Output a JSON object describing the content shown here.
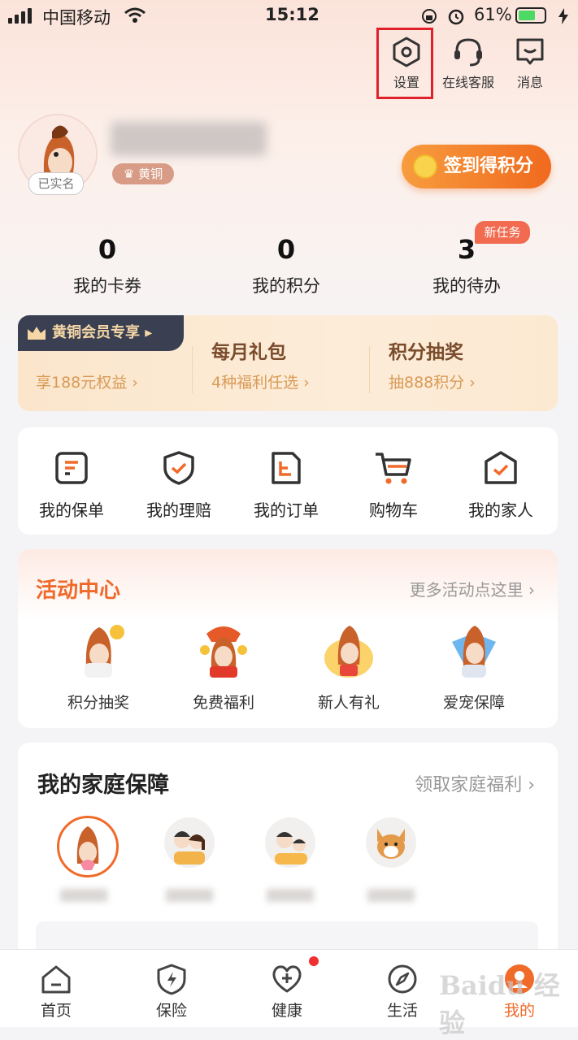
{
  "status_bar": {
    "carrier": "中国移动",
    "time": "15:12",
    "battery": "61%"
  },
  "top_actions": [
    {
      "label": "设置",
      "icon": "gear-hex-icon"
    },
    {
      "label": "在线客服",
      "icon": "headset-icon"
    },
    {
      "label": "消息",
      "icon": "message-icon"
    }
  ],
  "profile": {
    "verified": "已实名",
    "level": "黄铜",
    "signin": "签到得积分"
  },
  "stats": [
    {
      "value": "0",
      "label": "我的卡券"
    },
    {
      "value": "0",
      "label": "我的积分"
    },
    {
      "value": "3",
      "label": "我的待办"
    }
  ],
  "new_task_badge": "新任务",
  "member": {
    "tag": "黄铜会员专享 ▸",
    "tag_sub": "享188元权益 ›",
    "items": [
      {
        "title": "每月礼包",
        "sub": "4种福利任选 ›"
      },
      {
        "title": "积分抽奖",
        "sub": "抽888积分 ›"
      }
    ]
  },
  "menu": [
    {
      "label": "我的保单",
      "icon": "policy-icon"
    },
    {
      "label": "我的理赔",
      "icon": "shield-check-icon"
    },
    {
      "label": "我的订单",
      "icon": "order-icon"
    },
    {
      "label": "购物车",
      "icon": "cart-icon"
    },
    {
      "label": "我的家人",
      "icon": "family-icon"
    }
  ],
  "activity": {
    "title": "活动中心",
    "more": "更多活动点这里 ›",
    "items": [
      {
        "label": "积分抽奖"
      },
      {
        "label": "免费福利"
      },
      {
        "label": "新人有礼"
      },
      {
        "label": "爱宠保障"
      }
    ]
  },
  "family": {
    "title": "我的家庭保障",
    "more": "领取家庭福利 ›"
  },
  "tabs": [
    {
      "label": "首页",
      "icon": "home-icon"
    },
    {
      "label": "保险",
      "icon": "insurance-icon"
    },
    {
      "label": "健康",
      "icon": "health-icon"
    },
    {
      "label": "生活",
      "icon": "compass-icon"
    },
    {
      "label": "我的",
      "icon": "profile-icon"
    }
  ],
  "watermark": "Baidu 经验",
  "colors": {
    "accent": "#f06a2a",
    "highlight_box": "#e0202a"
  }
}
